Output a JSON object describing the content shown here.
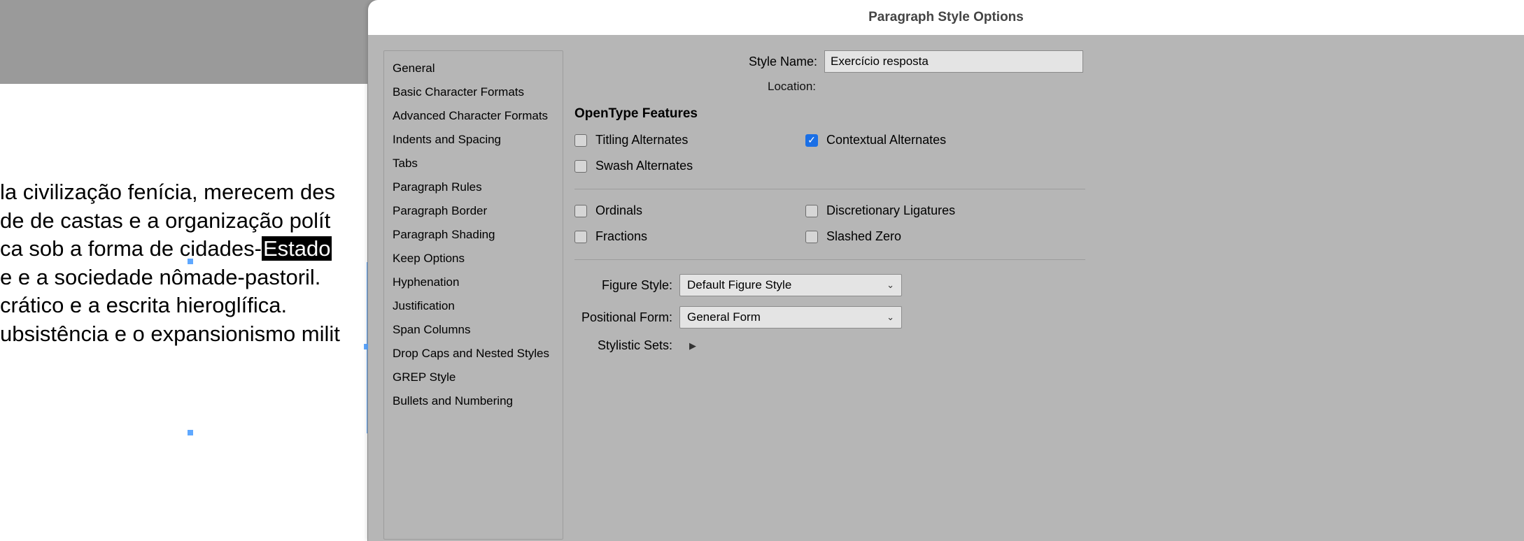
{
  "dialog": {
    "title": "Paragraph Style Options",
    "style_name_label": "Style Name:",
    "style_name_value": "Exercício resposta",
    "location_label": "Location:",
    "section_title": "OpenType Features",
    "figure_style_label": "Figure Style:",
    "figure_style_value": "Default Figure Style",
    "positional_form_label": "Positional Form:",
    "positional_form_value": "General Form",
    "stylistic_sets_label": "Stylistic Sets:"
  },
  "sidebar": {
    "items": [
      "General",
      "Basic Character Formats",
      "Advanced Character Formats",
      "Indents and Spacing",
      "Tabs",
      "Paragraph Rules",
      "Paragraph Border",
      "Paragraph Shading",
      "Keep Options",
      "Hyphenation",
      "Justification",
      "Span Columns",
      "Drop Caps and Nested Styles",
      "GREP Style",
      "Bullets and Numbering"
    ]
  },
  "checkboxes": {
    "titling": {
      "label": "Titling Alternates",
      "checked": false
    },
    "contextual": {
      "label": "Contextual Alternates",
      "checked": true
    },
    "swash": {
      "label": "Swash Alternates",
      "checked": false
    },
    "ordinals": {
      "label": "Ordinals",
      "checked": false
    },
    "discretionary": {
      "label": "Discretionary Ligatures",
      "checked": false
    },
    "fractions": {
      "label": "Fractions",
      "checked": false
    },
    "slashed": {
      "label": "Slashed Zero",
      "checked": false
    }
  },
  "canvas": {
    "line1_a": "la civilização fenícia, merecem des",
    "line2_a": "de de castas e a organização polít",
    "line3_a": "ca sob a forma de cidades-",
    "line3_sel": "Estado",
    "line4_a": "e e a sociedade nômade-pastoril.",
    "line5_a": "crático e a escrita hieroglífica.",
    "line6_a": "ubsistência e o expansionismo milit"
  }
}
